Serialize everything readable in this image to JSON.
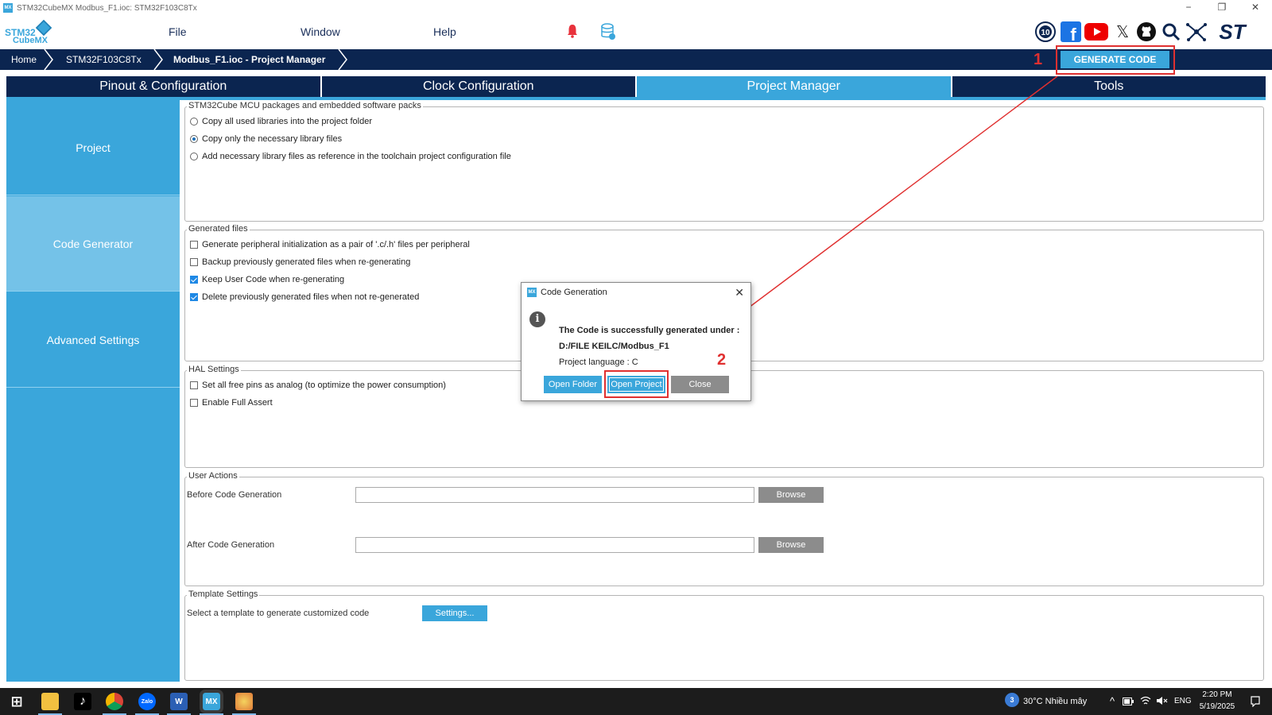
{
  "window": {
    "title": "STM32CubeMX Modbus_F1.ioc: STM32F103C8Tx",
    "app_badge": "MX",
    "minimize": "−",
    "restore": "❐",
    "close": "✕"
  },
  "logo": {
    "line1": "STM32",
    "line2": "CubeMX"
  },
  "menu": {
    "items": [
      "File",
      "Window",
      "Help"
    ]
  },
  "social": [
    "10-year-icon",
    "facebook-icon",
    "youtube-icon",
    "x-icon",
    "github-icon",
    "search-icon",
    "network-icon",
    "st-logo"
  ],
  "social_labels": {
    "ten": "10",
    "facebook": "f",
    "x": "𝕏",
    "st": "ST"
  },
  "breadcrumb": {
    "items": [
      "Home",
      "STM32F103C8Tx",
      "Modbus_F1.ioc - Project Manager"
    ]
  },
  "generate_code": {
    "label": "GENERATE CODE"
  },
  "annotations": {
    "step1": "1",
    "step2": "2",
    "color": "#e03030"
  },
  "tabs": [
    {
      "label": "Pinout & Configuration",
      "active": false
    },
    {
      "label": "Clock Configuration",
      "active": false
    },
    {
      "label": "Project Manager",
      "active": true
    },
    {
      "label": "Tools",
      "active": false
    }
  ],
  "sidebar": {
    "items": [
      {
        "label": "Project",
        "active": false
      },
      {
        "label": "Code Generator",
        "active": true
      },
      {
        "label": "Advanced Settings",
        "active": false
      }
    ]
  },
  "packages": {
    "title": "STM32Cube MCU packages and embedded software packs",
    "options": [
      {
        "label": "Copy all used libraries into the project folder",
        "selected": false
      },
      {
        "label": "Copy only the necessary library files",
        "selected": true
      },
      {
        "label": "Add necessary library files as reference in the toolchain project configuration file",
        "selected": false
      }
    ]
  },
  "generated_files": {
    "title": "Generated files",
    "options": [
      {
        "label": "Generate peripheral initialization as a pair of '.c/.h' files per peripheral",
        "checked": false
      },
      {
        "label": "Backup previously generated files when re-generating",
        "checked": false
      },
      {
        "label": "Keep User Code when re-generating",
        "checked": true
      },
      {
        "label": "Delete previously generated files when not re-generated",
        "checked": true
      }
    ]
  },
  "hal_settings": {
    "title": "HAL Settings",
    "options": [
      {
        "label": "Set all free pins as analog (to optimize the power consumption)",
        "checked": false
      },
      {
        "label": "Enable Full Assert",
        "checked": false
      }
    ]
  },
  "user_actions": {
    "title": "User Actions",
    "before_label": "Before Code Generation",
    "before_value": "",
    "after_label": "After Code Generation",
    "after_value": "",
    "browse_label": "Browse"
  },
  "template_settings": {
    "title": "Template Settings",
    "label": "Select a template to generate customized code",
    "button": "Settings..."
  },
  "dialog": {
    "badge": "MX",
    "title": "Code Generation",
    "close": "✕",
    "info": "i",
    "message": "The Code is successfully generated under :",
    "path": "D:/FILE KEILC/Modbus_F1",
    "language": "Project language : C",
    "buttons": {
      "open_folder": "Open Folder",
      "open_project": "Open Project",
      "close": "Close"
    }
  },
  "taskbar": {
    "start": "⊞",
    "apps": [
      "file-explorer-icon",
      "tiktok-icon",
      "chrome-icon",
      "zalo-icon",
      "word-icon",
      "cubemx-icon",
      "paint-icon"
    ],
    "app_labels": {
      "tiktok": "♪",
      "zalo": "Zalo",
      "word": "W",
      "cubemx": "MX"
    },
    "weather_badge": "3",
    "weather": "30°C  Nhiều mây",
    "tray": "^",
    "language": "ENG",
    "time": "2:20 PM",
    "date": "5/19/2025"
  }
}
